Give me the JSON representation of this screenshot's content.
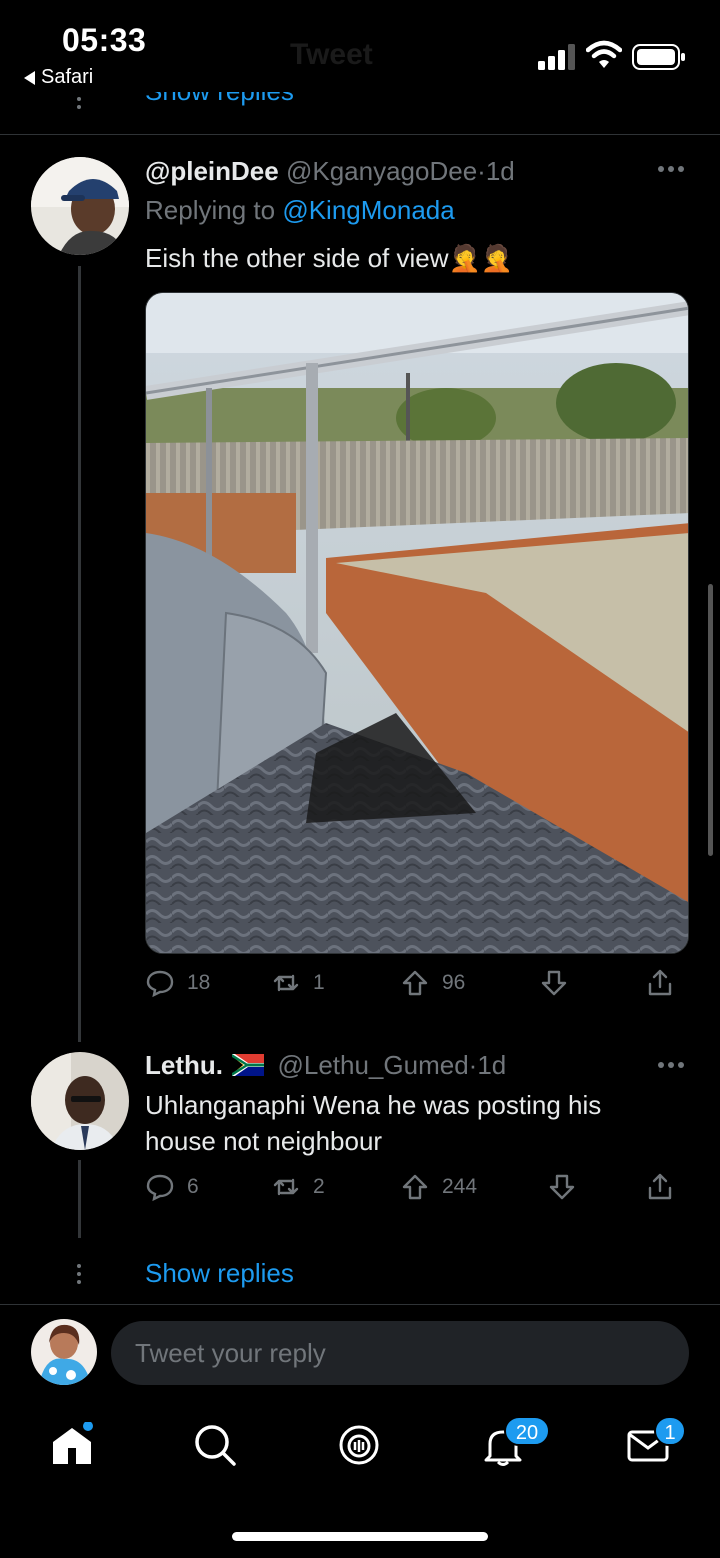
{
  "status_bar": {
    "time": "05:33",
    "back_label": "Safari",
    "ghost_title": "Tweet"
  },
  "top_thread": {
    "show_replies": "Show replies"
  },
  "tweet1": {
    "display_name": "@pleinDee",
    "handle": "@KganyagoDee",
    "separator": "·",
    "age": "1d",
    "replying_prefix": "Replying to",
    "replying_to": "@KingMonada",
    "text": "Eish the other side of view",
    "emoji": "🤦🤦",
    "replies": "18",
    "retweets": "1",
    "upvotes": "96"
  },
  "tweet2": {
    "display_name": "Lethu.",
    "flag_icon": "south-africa-flag-icon",
    "handle": "@Lethu_Gumed",
    "separator": "·",
    "age": "1d",
    "text": "Uhlanganaphi Wena he was posting his house not neighbour",
    "replies": "6",
    "retweets": "2",
    "upvotes": "244",
    "show_replies": "Show replies"
  },
  "reply_bar": {
    "placeholder": "Tweet your reply"
  },
  "tab_bar": {
    "notifications_badge": "20",
    "messages_badge": "1"
  },
  "colors": {
    "accent": "#1d9bf0",
    "muted": "#71767b",
    "background": "#000000"
  }
}
